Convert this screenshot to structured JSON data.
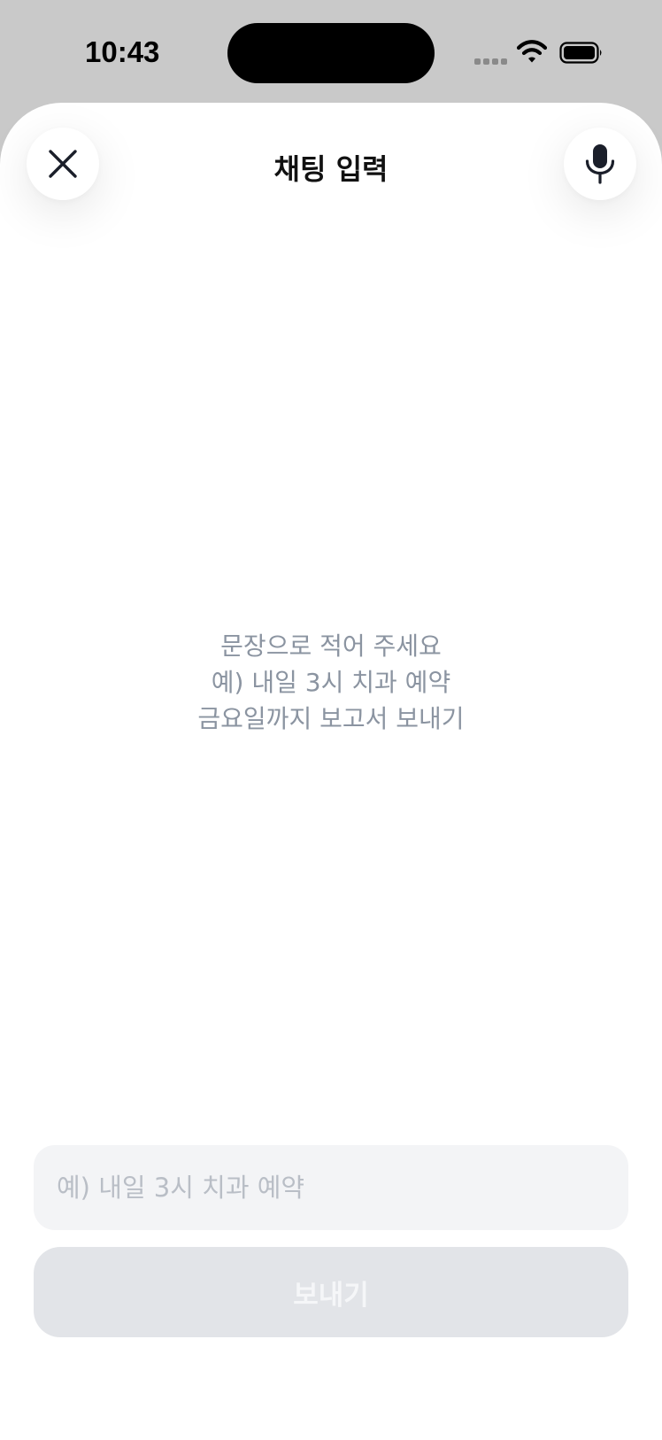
{
  "status_bar": {
    "time": "10:43",
    "icons": [
      "cellular-signal-icon",
      "wifi-icon",
      "battery-icon"
    ]
  },
  "header": {
    "title": "채팅 입력",
    "left_icon": "close-icon",
    "right_icon": "microphone-icon"
  },
  "hint": {
    "lines": [
      "문장으로 적어 주세요",
      "예) 내일 3시 치과 예약",
      "금요일까지 보고서 보내기"
    ]
  },
  "input": {
    "value": "",
    "placeholder": "예) 내일 3시 치과 예약"
  },
  "send_button": {
    "label": "보내기",
    "state": "disabled"
  },
  "colors": {
    "background_dim": "#c9c9c9",
    "sheet": "#ffffff",
    "hint_text": "#8b94a1",
    "input_bg": "#f3f4f6",
    "button_disabled_bg": "#e2e4e8"
  }
}
